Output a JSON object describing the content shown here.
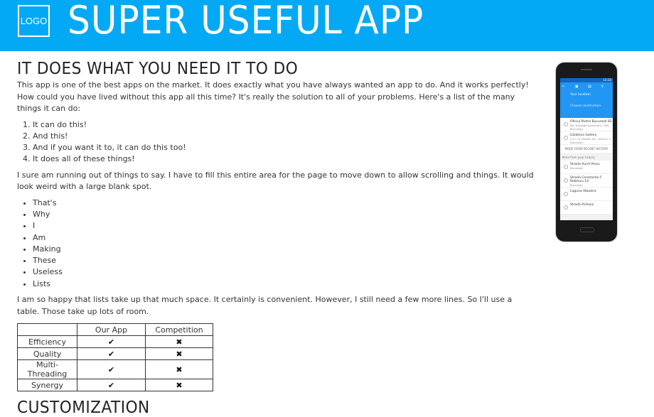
{
  "header": {
    "logo_text": "LOGO",
    "title": "SUPER USEFUL APP",
    "bg_color": "#03A9F4"
  },
  "section1": {
    "heading": "IT DOES WHAT YOU NEED IT TO DO",
    "intro": "This app is one of the best apps on the market. It does exactly what you have always wanted an app to do. And it works perfectly! How could you have lived without this app all this time? It's really the solution to all of your problems. Here's a list of the many things it can do:",
    "ordered_list": [
      "It can do this!",
      "And this!",
      "And if you want it to, it can do this too!",
      "It does all of these things!"
    ],
    "filler": "I sure am running out of things to say. I have to fill this entire area for the page to move down to allow scrolling and things. It would look weird with a large blank spot.",
    "bullet_list": [
      "That's",
      "Why",
      "I",
      "Am",
      "Making",
      "These",
      "Useless",
      "Lists"
    ],
    "closing": "I am so happy that lists take up that much space. It certainly is convenient. However, I still need a few more lines. So I'll use a table. Those take up lots of room."
  },
  "comparison_table": {
    "headers": [
      "",
      "Our App",
      "Competition"
    ],
    "rows": [
      {
        "feature": "Efficiency",
        "ours": "✔",
        "competition": "✖"
      },
      {
        "feature": "Quality",
        "ours": "✔",
        "competition": "✖"
      },
      {
        "feature": "Multi-Threading",
        "ours": "✔",
        "competition": "✖"
      },
      {
        "feature": "Synergy",
        "ours": "✔",
        "competition": "✖"
      }
    ]
  },
  "section2": {
    "heading": "CUSTOMIZATION"
  },
  "phone_screen": {
    "status_time": "12:22",
    "your_location": "Your location",
    "choose_destination": "Choose destination",
    "recent": [
      {
        "title": "Oficiul Postal București 82",
        "subtitle": "Bd. Dâmbița Alexandru, 25B, București"
      },
      {
        "title": "Galateca Gallery",
        "subtitle": "2-4 C.A. Rosetti Str., District 1, Bucureşti"
      }
    ],
    "more_label": "MORE FROM RECENT HISTORY",
    "history_label": "More from your history",
    "history": [
      {
        "title": "Strada Aurel Perșu",
        "subtitle": "București"
      },
      {
        "title": "Strada Constantin F. Robescu 14",
        "subtitle": "București"
      },
      {
        "title": "Laguna Albastra",
        "subtitle": ""
      },
      {
        "title": "Strada Portului",
        "subtitle": ""
      }
    ]
  }
}
